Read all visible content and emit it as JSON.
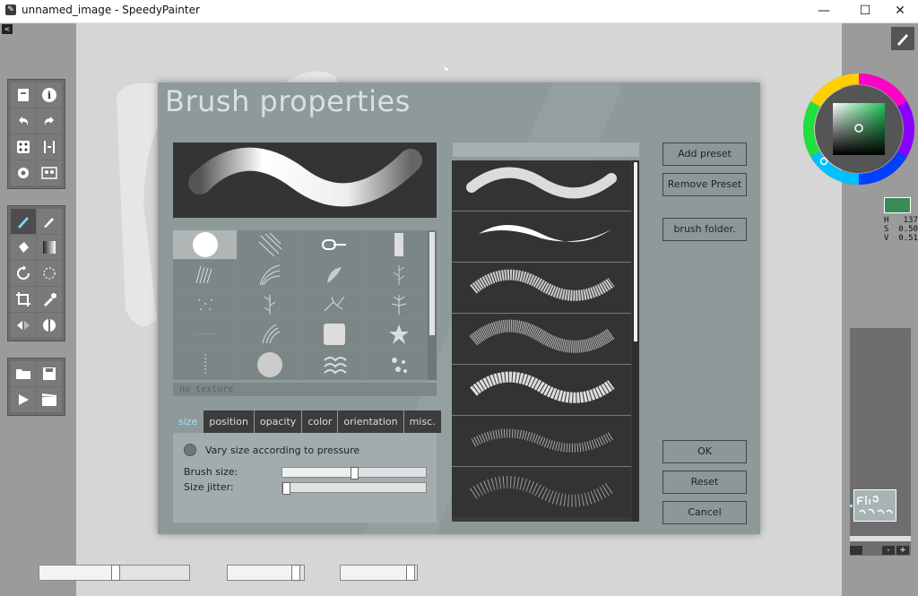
{
  "window": {
    "title": "unnamed_image - SpeedyPainter",
    "minimize": "—",
    "maximize": "☐",
    "close": "✕",
    "collapse": "<"
  },
  "left_tools": [
    [
      "new-doc-icon",
      "info-icon"
    ],
    [
      "undo-icon",
      "redo-icon"
    ],
    [
      "random-icon",
      "flip-icon"
    ],
    [
      "settings-icon",
      "reference-icon"
    ],
    [
      "brush-icon",
      "pen-icon"
    ],
    [
      "fill-icon",
      "gradient-icon"
    ],
    [
      "rotate-icon",
      "lasso-icon"
    ],
    [
      "crop-icon",
      "eyedropper-icon"
    ],
    [
      "mirror-icon",
      "symmetry-icon"
    ],
    [
      "open-folder-icon",
      "save-icon"
    ],
    [
      "play-icon",
      "record-icon"
    ]
  ],
  "color": {
    "h_line": "H   137",
    "s_line": "S  0.50",
    "v_line": "V  0.51",
    "current": "#3c8a58"
  },
  "layers": {
    "minus_label": "-",
    "plus_label": "+"
  },
  "dialog": {
    "title": "Brush properties",
    "no_texture": "no texture",
    "tabs": [
      "size",
      "position",
      "opacity",
      "color",
      "orientation",
      "misc."
    ],
    "active_tab": "size",
    "vary_size_label": "Vary size according to pressure",
    "brush_size_label": "Brush size:",
    "brush_size_value": 0.5,
    "size_jitter_label": "Size jitter:",
    "size_jitter_value": 0.0,
    "buttons": {
      "add_preset": "Add preset",
      "remove_preset": "Remove Preset",
      "brush_folder": "brush folder.",
      "ok": "OK",
      "reset": "Reset",
      "cancel": "Cancel"
    }
  },
  "bottom_sliders": [
    0.5,
    0.92,
    0.95
  ]
}
